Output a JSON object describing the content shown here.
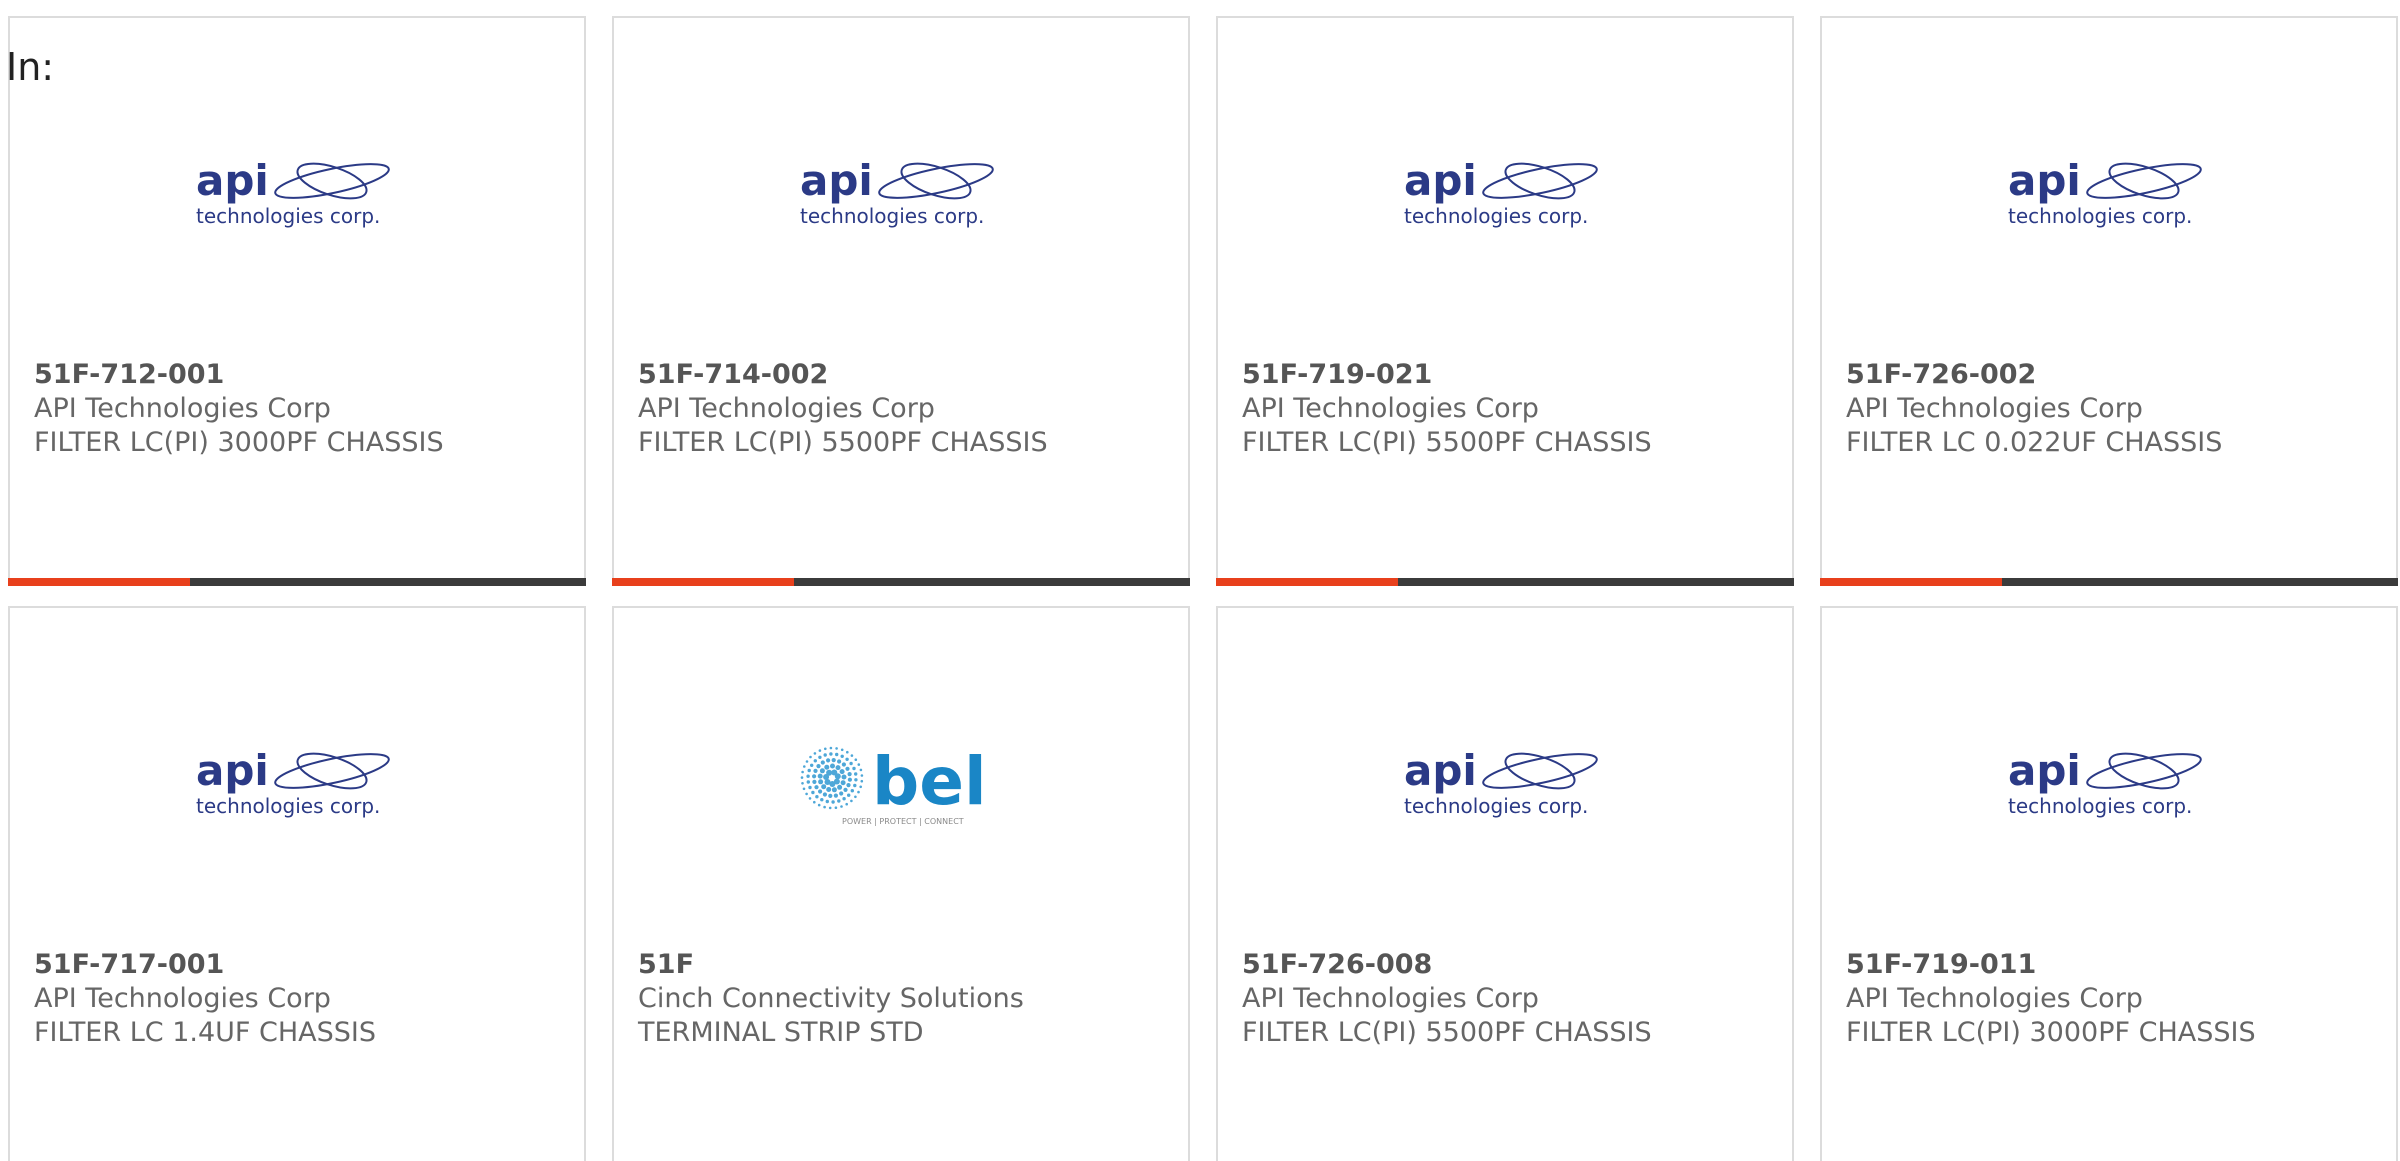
{
  "header": {
    "label": "In:"
  },
  "logos": {
    "api": {
      "word": "api",
      "sub": "technologies corp.",
      "color": "#2b3a86"
    },
    "bel": {
      "word": "bel",
      "sub": "POWER | PROTECT | CONNECT",
      "color": "#1a86c6"
    }
  },
  "colors": {
    "accent": "#e8401c",
    "bar": "#3b3b3b",
    "border": "#dcdcdc"
  },
  "products": [
    {
      "part": "51F-712-001",
      "manufacturer": "API Technologies Corp",
      "description": "FILTER LC(PI) 3000PF CHASSIS",
      "logo": "api"
    },
    {
      "part": "51F-714-002",
      "manufacturer": "API Technologies Corp",
      "description": "FILTER LC(PI) 5500PF CHASSIS",
      "logo": "api"
    },
    {
      "part": "51F-719-021",
      "manufacturer": "API Technologies Corp",
      "description": "FILTER LC(PI) 5500PF CHASSIS",
      "logo": "api"
    },
    {
      "part": "51F-726-002",
      "manufacturer": "API Technologies Corp",
      "description": "FILTER LC 0.022UF CHASSIS",
      "logo": "api"
    },
    {
      "part": "51F-717-001",
      "manufacturer": "API Technologies Corp",
      "description": "FILTER LC 1.4UF CHASSIS",
      "logo": "api"
    },
    {
      "part": "51F",
      "manufacturer": "Cinch Connectivity Solutions",
      "description": "TERMINAL STRIP STD",
      "logo": "bel"
    },
    {
      "part": "51F-726-008",
      "manufacturer": "API Technologies Corp",
      "description": "FILTER LC(PI) 5500PF CHASSIS",
      "logo": "api"
    },
    {
      "part": "51F-719-011",
      "manufacturer": "API Technologies Corp",
      "description": "FILTER LC(PI) 3000PF CHASSIS",
      "logo": "api"
    }
  ]
}
